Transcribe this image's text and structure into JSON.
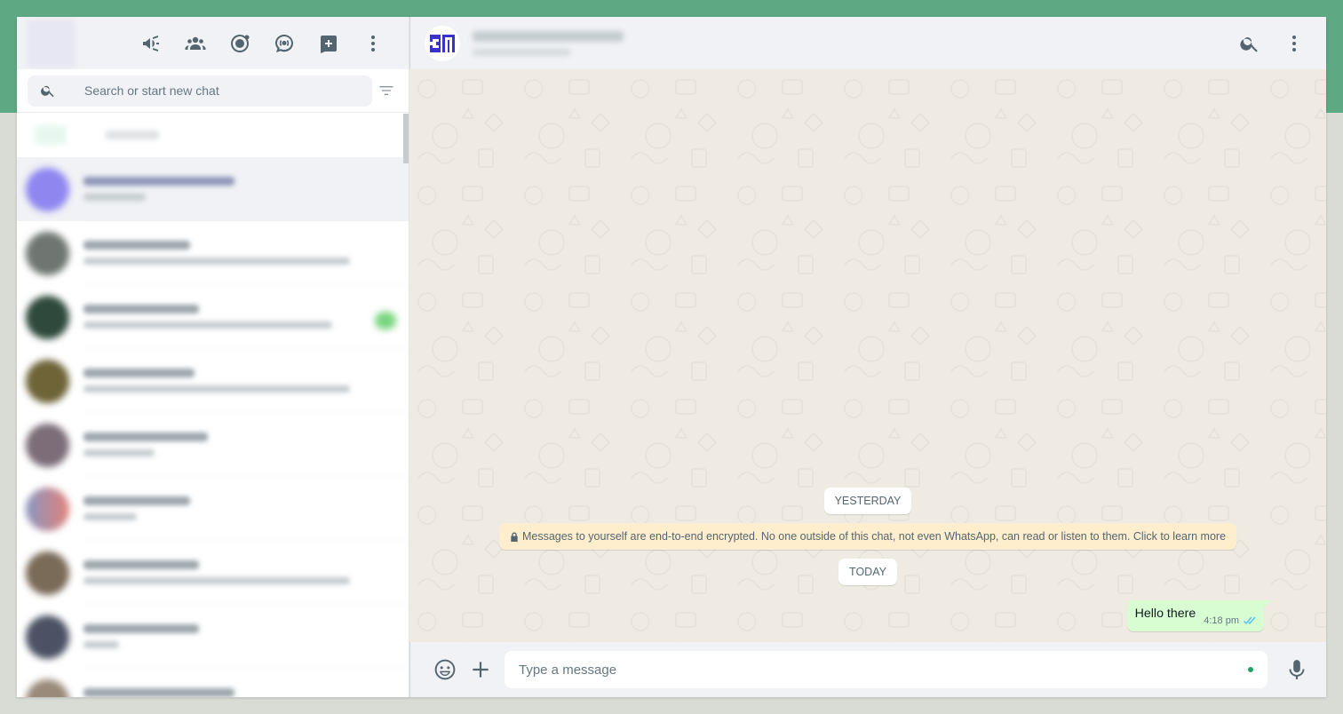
{
  "sidebar": {
    "search": {
      "placeholder": "Search or start new chat"
    },
    "header_icons": [
      "communities-icon",
      "groups-icon",
      "status-icon",
      "channels-icon",
      "new-chat-icon",
      "menu-icon"
    ]
  },
  "conversation": {
    "date_yesterday": "YESTERDAY",
    "encryption_note": "Messages to yourself are end-to-end encrypted. No one outside of this chat, not even WhatsApp, can read or listen to them. Click to learn more",
    "date_today": "TODAY",
    "messages": [
      {
        "text": "Hello there",
        "time": "4:18 pm",
        "status": "read"
      }
    ]
  },
  "composer": {
    "placeholder": "Type a message"
  },
  "colors": {
    "accent_band": "#5ea883",
    "outgoing_bubble": "#d9fdd3",
    "system_note": "#ffeecd",
    "read_ticks": "#53bdeb",
    "brand_avatar": "#3b33c8"
  }
}
